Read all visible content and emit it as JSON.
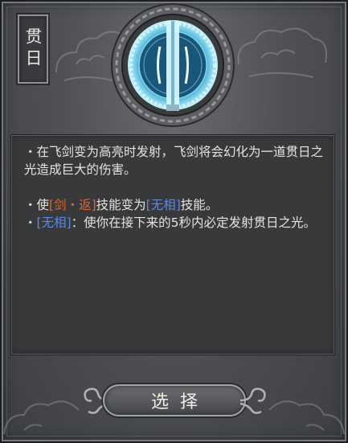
{
  "skill": {
    "title": "贯日",
    "emblem_icon": "sword-blade-ring-icon"
  },
  "description": {
    "line1_bullet": "・",
    "line1_text": "在飞剑变为高亮时发射，飞剑将会幻化为一道贯日之光造成巨大的伤害。",
    "line2_bullet": "・",
    "line2_pre": "使",
    "line2_skill": "[剑・返]",
    "line2_mid": "技能变为",
    "line2_tag": "[无相]",
    "line2_post": "技能。",
    "line3_bullet": "・",
    "line3_tag": "[无相]",
    "line3_text": "：使你在接下来的5秒内必定发射贯日之光。"
  },
  "button": {
    "select_label": "选择"
  },
  "colors": {
    "skill_highlight": "#e3622d",
    "tag_highlight": "#5b8be0",
    "emblem_glow": "#9fe6f5"
  }
}
